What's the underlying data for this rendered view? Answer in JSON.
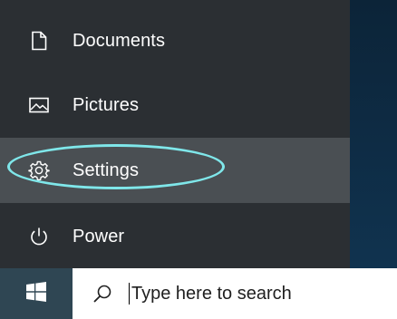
{
  "start_menu": {
    "items": [
      {
        "label": "Documents",
        "icon": "document-icon"
      },
      {
        "label": "Pictures",
        "icon": "pictures-icon"
      },
      {
        "label": "Settings",
        "icon": "gear-icon",
        "hovered": true,
        "annotated": true
      },
      {
        "label": "Power",
        "icon": "power-icon"
      }
    ]
  },
  "taskbar": {
    "start_icon": "windows-logo-icon",
    "search": {
      "placeholder": "Type here to search",
      "icon": "search-icon"
    }
  },
  "colors": {
    "menu_background": "#2b2f33",
    "hover_background": "#4a4f53",
    "annotation_ellipse": "#7fe7ea",
    "start_button_background": "#2f4653",
    "search_background": "#ffffff"
  }
}
